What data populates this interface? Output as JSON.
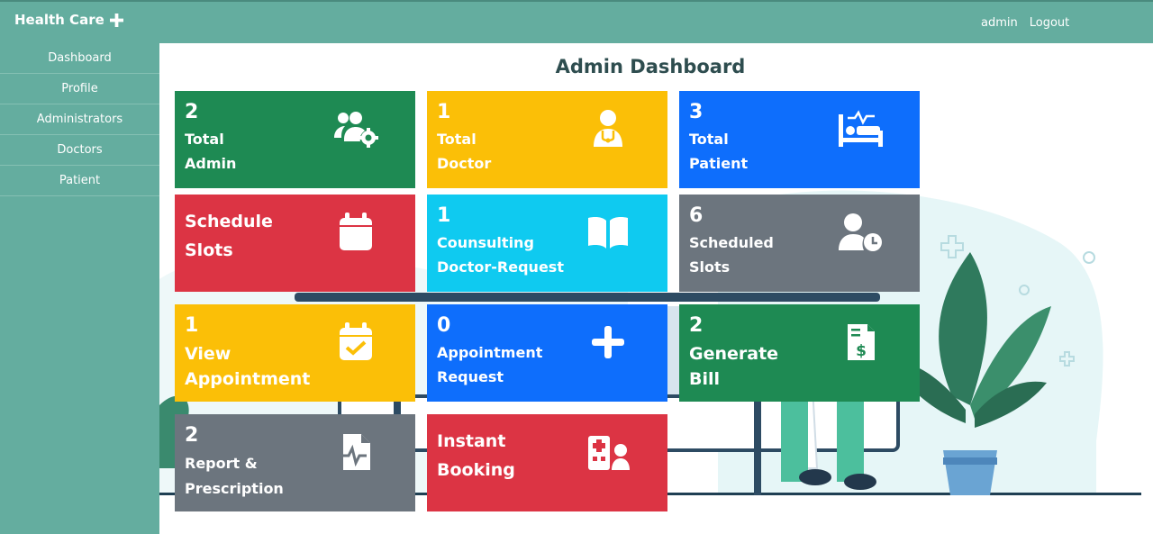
{
  "brand": {
    "title": "Health Care",
    "icon": "plus-icon"
  },
  "header": {
    "user": "admin",
    "logout": "Logout"
  },
  "sidebar": {
    "items": [
      {
        "label": "Dashboard"
      },
      {
        "label": "Profile"
      },
      {
        "label": "Administrators"
      },
      {
        "label": "Doctors"
      },
      {
        "label": "Patient"
      }
    ]
  },
  "main": {
    "title": "Admin Dashboard"
  },
  "cards": [
    {
      "count": "2",
      "line1": "Total",
      "line2": "Admin",
      "color": "#1e8a53",
      "icon": "users-gear-icon"
    },
    {
      "count": "1",
      "line1": "Total",
      "line2": "Doctor",
      "color": "#fbbf07",
      "icon": "doctor-icon"
    },
    {
      "count": "3",
      "line1": "Total",
      "line2": "Patient",
      "color": "#0e6efc",
      "icon": "hospital-bed-icon"
    },
    {
      "line1": "Schedule",
      "line2": "Slots",
      "color": "#dc3444",
      "icon": "calendar-icon"
    },
    {
      "count": "1",
      "line1": "Counsulting",
      "line2": "Doctor-Request",
      "color": "#0fcaf0",
      "icon": "book-open-icon"
    },
    {
      "count": "6",
      "line1": "Scheduled",
      "line2": "Slots",
      "color": "#6c757e",
      "icon": "user-clock-icon"
    },
    {
      "count": "1",
      "line1": "View",
      "line2": "Appointment",
      "color": "#fbbf07",
      "icon": "calendar-check-icon"
    },
    {
      "count": "0",
      "line1": "Appointment",
      "line2": "Request",
      "color": "#0e6efc",
      "icon": "plus-icon"
    },
    {
      "count": "2",
      "line1": "Generate",
      "line2": "Bill",
      "color": "#1e8a53",
      "icon": "invoice-dollar-icon"
    },
    {
      "count": "2",
      "line1": "Report &",
      "line2": "Prescription",
      "color": "#6c757e",
      "icon": "file-medical-icon"
    },
    {
      "line1": "Instant",
      "line2": "Booking",
      "color": "#dc3444",
      "icon": "hospital-user-icon"
    }
  ]
}
